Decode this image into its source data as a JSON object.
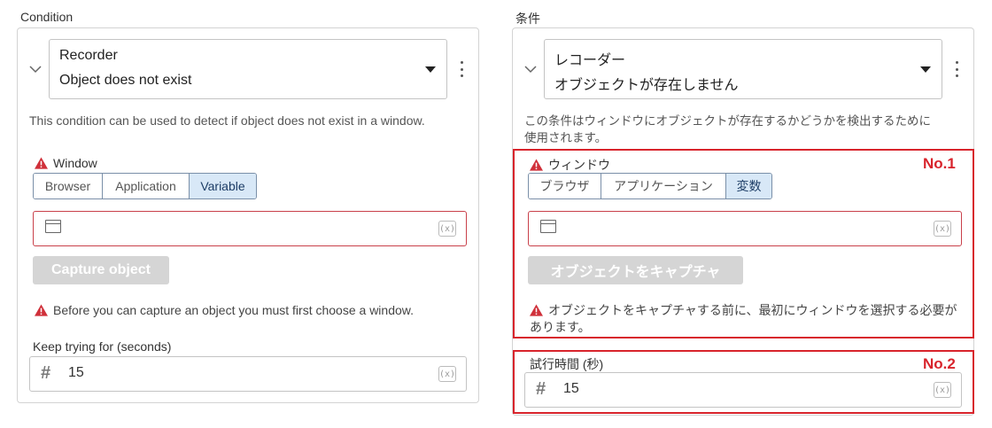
{
  "left": {
    "section_label": "Condition",
    "module": "Recorder",
    "condition": "Object does not exist",
    "description": "This condition can be used to detect if object does not exist in a window.",
    "window_label": "Window",
    "target_options": [
      {
        "label": "Browser",
        "active": false
      },
      {
        "label": "Application",
        "active": false
      },
      {
        "label": "Variable",
        "active": true
      }
    ],
    "capture_button": "Capture object",
    "capture_note": "Before you can capture an object you must first choose a window.",
    "timeout_label": "Keep trying for (seconds)",
    "timeout_value": "15",
    "variable_badge": "(x)"
  },
  "right": {
    "section_label": "条件",
    "module": "レコーダー",
    "condition": "オブジェクトが存在しません",
    "description": "この条件はウィンドウにオブジェクトが存在するかどうかを検出するために使用されます。",
    "window_label": "ウィンドウ",
    "target_options": [
      {
        "label": "ブラウザ",
        "active": false
      },
      {
        "label": "アプリケーション",
        "active": false
      },
      {
        "label": "変数",
        "active": true
      }
    ],
    "capture_button": "オブジェクトをキャプチャ",
    "capture_note": "オブジェクトをキャプチャする前に、最初にウィンドウを選択する必要があります。",
    "timeout_label": "試行時間 (秒)",
    "timeout_value": "15",
    "variable_badge": "(x)",
    "annotations": [
      "No.1",
      "No.2"
    ]
  },
  "colors": {
    "error_border": "#c9404a",
    "warning_icon": "#d0303a",
    "highlight_red": "#d8242c",
    "active_segment": "#d8e8f7"
  },
  "icons": [
    "chevron-down-icon",
    "caret-down-icon",
    "kebab-menu-icon",
    "warning-icon",
    "window-icon",
    "hash-icon",
    "variable-icon"
  ]
}
